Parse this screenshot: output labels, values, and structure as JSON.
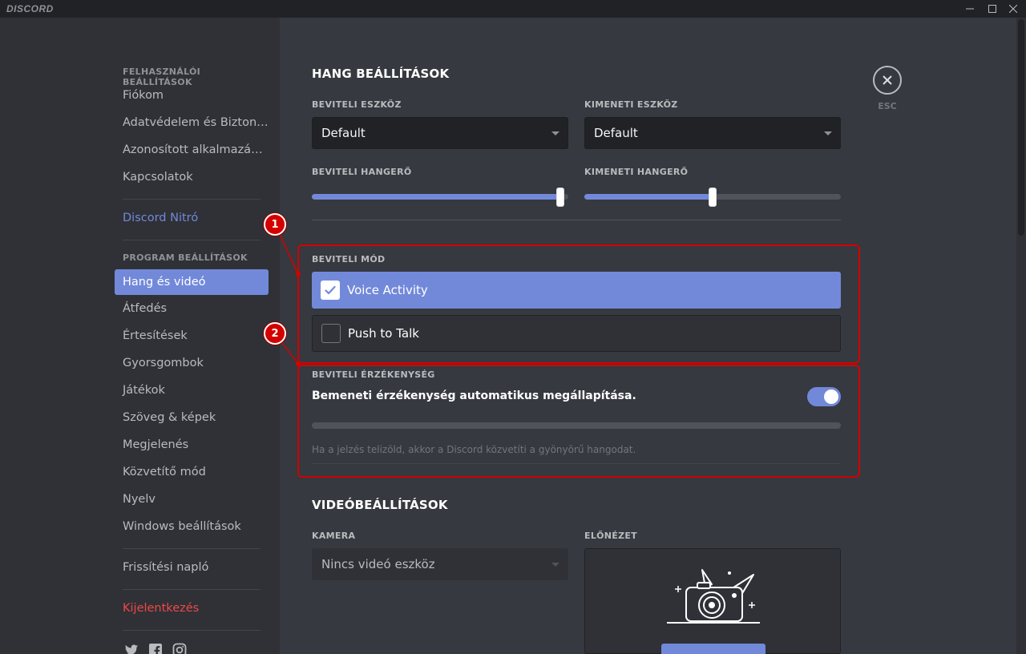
{
  "window": {
    "brand": "DISCORD"
  },
  "sidebar": {
    "user_header": "FELHASZNÁLÓI BEÁLLÍTÁSOK",
    "user_items": [
      "Fiókom",
      "Adatvédelem és Biztonság",
      "Azonosított alkalmazások",
      "Kapcsolatok"
    ],
    "nitro": "Discord Nitró",
    "app_header": "PROGRAM BEÁLLÍTÁSOK",
    "app_items": [
      "Hang és videó",
      "Átfedés",
      "Értesítések",
      "Gyorsgombok",
      "Játékok",
      "Szöveg & képek",
      "Megjelenés",
      "Közvetítő mód",
      "Nyelv",
      "Windows beállítások"
    ],
    "changelog": "Frissítési napló",
    "logout": "Kijelentkezés"
  },
  "voice": {
    "title": "HANG BEÁLLÍTÁSOK",
    "input_device_label": "BEVITELI ESZKÖZ",
    "input_device_value": "Default",
    "output_device_label": "KIMENETI ESZKÖZ",
    "output_device_value": "Default",
    "input_volume_label": "BEVITELI HANGERŐ",
    "input_volume_fraction": 0.97,
    "output_volume_label": "KIMENETI HANGERŐ",
    "output_volume_fraction": 0.5,
    "input_mode_label": "BEVITELI MÓD",
    "voice_activity": "Voice Activity",
    "push_to_talk": "Push to Talk",
    "sensitivity_label": "BEVITELI ÉRZÉKENYSÉG",
    "auto_sensitivity": "Bemeneti érzékenység automatikus megállapítása.",
    "auto_sensitivity_on": true,
    "hint": "Ha a jelzés telizöld, akkor a Discord közvetíti a gyönyörű hangodat."
  },
  "video": {
    "title": "VIDEÓBEÁLLÍTÁSOK",
    "camera_label": "KAMERA",
    "camera_value": "Nincs videó eszköz",
    "preview_label": "ELŐNÉZET"
  },
  "close": {
    "label": "ESC"
  },
  "annotations": [
    "1",
    "2"
  ],
  "colors": {
    "accent": "#7289da",
    "danger": "#f04747",
    "annotation": "#d40000"
  }
}
